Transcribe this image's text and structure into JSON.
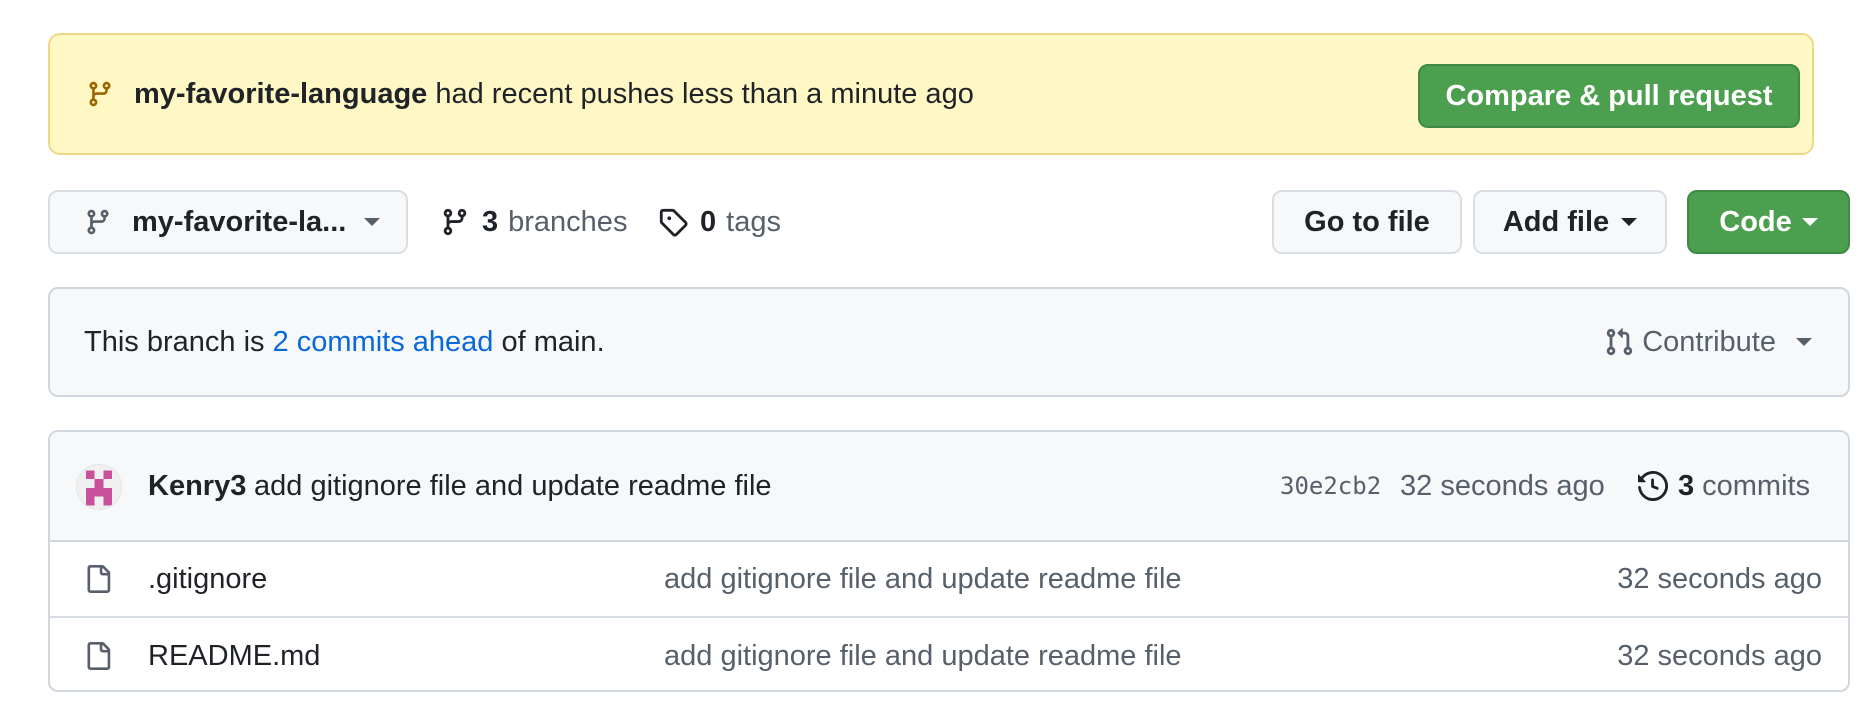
{
  "banner": {
    "branch_name": "my-favorite-language",
    "message": " had recent pushes less than a minute ago",
    "compare_button": "Compare & pull request",
    "icon": "git-branch-icon"
  },
  "toolbar": {
    "branch_select_label": "my-favorite-la...",
    "branches_count": "3",
    "branches_label": "branches",
    "tags_count": "0",
    "tags_label": "tags",
    "go_to_file": "Go to file",
    "add_file": "Add file",
    "code": "Code"
  },
  "ahead": {
    "prefix": "This branch is ",
    "link": "2 commits ahead",
    "suffix": " of main.",
    "contribute": "Contribute",
    "icon": "git-pull-request-icon"
  },
  "latest_commit": {
    "author": "Kenry3",
    "message": "add gitignore file and update readme file",
    "sha": "30e2cb2",
    "time": "32 seconds ago",
    "commits_count": "3",
    "commits_label": "commits"
  },
  "files": [
    {
      "name": ".gitignore",
      "message": "add gitignore file and update readme file",
      "time": "32 seconds ago",
      "icon": "file-icon"
    },
    {
      "name": "README.md",
      "message": "add gitignore file and update readme file",
      "time": "32 seconds ago",
      "icon": "file-icon"
    }
  ],
  "colors": {
    "banner_bg": "#fff8c5",
    "primary_green": "#4d9f50",
    "link_blue": "#0969da",
    "muted_text": "#57606a"
  }
}
